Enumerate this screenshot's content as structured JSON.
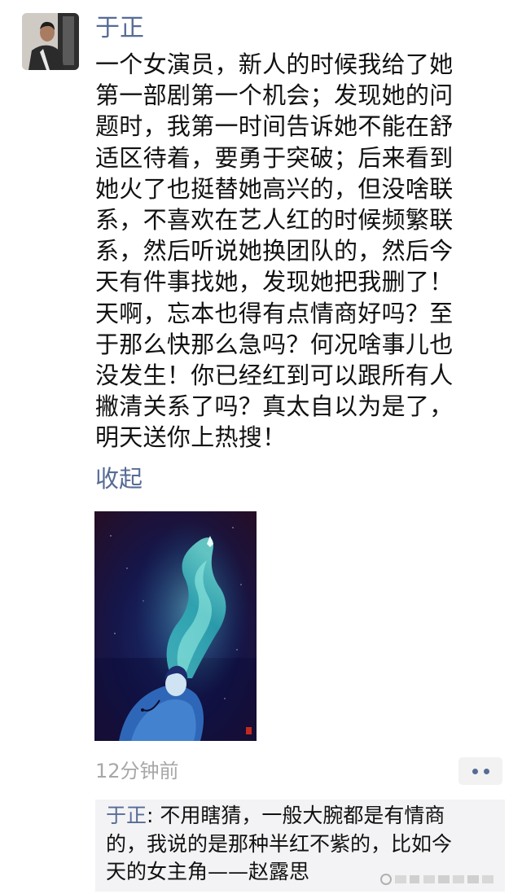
{
  "post": {
    "author": "于正",
    "body_lines": [
      "一个女演员，新人的时候我给了她",
      "第一部剧第一个机会；发现她的问",
      "题时，我第一时间告诉她不能在舒",
      "适区待着，要勇于突破；后来看到",
      "她火了也挺替她高兴的，但没啥联",
      "系，不喜欢在艺人红的时候频繁联",
      "系，然后听说她换团队的，然后今",
      "天有件事找她，发现她把我删了！",
      "天啊，忘本也得有点情商好吗？至",
      "于那么快那么急吗？何况啥事儿也",
      "没发生！你已经红到可以跟所有人",
      "撇清关系了吗？真太自以为是了，",
      "明天送你上热搜！"
    ],
    "collapse_label": "收起",
    "timestamp": "12分钟前"
  },
  "comment": {
    "author": "于正",
    "separator": ": ",
    "text_lines": [
      "不用瞎猜，一般大腕都是有情商",
      "的，我说的是那种半红不紫的，比如今",
      "天的女主角——赵露思"
    ]
  },
  "icons": {
    "more_button": "more-dots-icon",
    "avatar": "avatar-photo"
  },
  "colors": {
    "link": "#576b95",
    "text": "#111111",
    "timestamp": "#a7a7a7",
    "comment_bg": "#f3f3f5"
  }
}
